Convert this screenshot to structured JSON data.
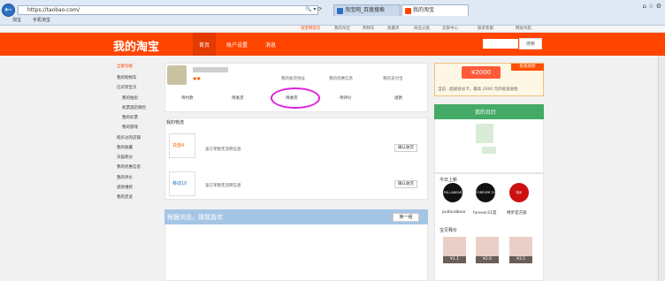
{
  "browser": {
    "url": "https://taobao.com/",
    "tabs": [
      "淘宝网_百度搜索",
      "我的淘宝"
    ],
    "favorites": [
      "淘宝",
      "手机淘宝"
    ]
  },
  "topstrip": {
    "items": [
      "淘宝网首页",
      "我的淘宝",
      "购物车",
      "收藏夹",
      "商品分类",
      "卖家中心",
      "联系客服",
      "网站导航"
    ]
  },
  "header": {
    "logo": "我的淘宝",
    "nav": [
      "首页",
      "账户设置",
      "消息"
    ],
    "search_button": "搜索"
  },
  "sidebar": {
    "items": [
      "全部功能",
      "我的购物车",
      "已买到宝贝",
      "我的拍卖",
      "机票酒店保险",
      "我的彩票",
      "我的游戏",
      "购买过的店铺",
      "我的收藏",
      "天猫积分",
      "我的优惠信息",
      "我的评价",
      "退款维权",
      "我的足迹"
    ]
  },
  "user_card": {
    "links": [
      "我的收货地址",
      "我的优惠信息",
      "我的支付宝"
    ],
    "order_tabs": [
      "待付款",
      "待发货",
      "待收货",
      "待评价",
      "退款"
    ]
  },
  "logistics": {
    "title": "我的物流",
    "rows": [
      {
        "img_label": "充值4",
        "text": "该订单暂无流转信息",
        "button": "确认收货"
      },
      {
        "img_label": "移动10",
        "text": "该订单暂无流转信息",
        "button": "确认收货"
      }
    ]
  },
  "guess": {
    "title": "根据浏览，猜我喜欢",
    "refresh": "换一组"
  },
  "promo": {
    "amount": "¥2000",
    "tag": "极速进款",
    "text": "当前...超级会员卡，最高 2000 元的极速进款"
  },
  "calendar": {
    "title": "我的日历"
  },
  "shops": {
    "title": "今日上新",
    "items": [
      {
        "logo": "PULL&BEAR",
        "name": "pullandbear"
      },
      {
        "logo": "FOREVER 21",
        "name": "forever21官"
      },
      {
        "logo": "特步",
        "name": "特步官方旗"
      }
    ]
  },
  "treasure": {
    "title": "宝贝释价",
    "prices": [
      "¥1.1",
      "¥2.6",
      "¥3.5"
    ]
  },
  "colors": {
    "brand": "#ff4400",
    "calendar_green": "#44aa66",
    "highlight_circle": "#e020e0"
  }
}
